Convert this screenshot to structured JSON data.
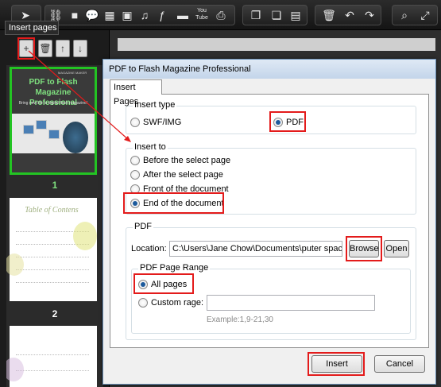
{
  "tooltip": "Insert pages",
  "toolbar": {
    "icons": [
      "cursor-icon",
      "link-icon",
      "shapes-icon",
      "speech-icon",
      "film-icon",
      "image-icon",
      "music-icon",
      "flash-icon",
      "button-icon",
      "youtube-icon",
      "printer-icon",
      "copy-page-icon",
      "paste-page-icon",
      "layout-icon",
      "trash-icon",
      "undo-icon",
      "redo-icon",
      "zoom-icon",
      "fit-icon"
    ],
    "youtube_label": "You Tube"
  },
  "left_panel": {
    "thumbnails": [
      {
        "number": "1",
        "title": "PDF to Flash Magazine Professional",
        "subtitle": "Bring new life to digital flash magazine!",
        "brand": "MAGAZINE MAKER"
      },
      {
        "number": "2",
        "title": "Table of Contens"
      },
      {
        "number": ""
      }
    ]
  },
  "dialog": {
    "title": "PDF to Flash Magazine Professional",
    "tab": "Insert Pages",
    "insert_type": {
      "label": "Insert type",
      "options": [
        {
          "label": "SWF/IMG",
          "selected": false
        },
        {
          "label": "PDF",
          "selected": true
        }
      ]
    },
    "insert_to": {
      "label": "Insert to",
      "options": [
        {
          "label": "Before the select page",
          "selected": false
        },
        {
          "label": "After the select page",
          "selected": false
        },
        {
          "label": "Front of the document",
          "selected": false
        },
        {
          "label": "End of the document",
          "selected": true
        }
      ]
    },
    "pdf": {
      "label": "PDF",
      "location_label": "Location:",
      "location_value": "C:\\Users\\Jane Chow\\Documents\\puter space.pdf",
      "browse_label": "Browse",
      "open_label": "Open",
      "range": {
        "label": "PDF Page Range",
        "all_pages_label": "All pages",
        "all_pages_selected": true,
        "custom_label": "Custom rage:",
        "custom_value": "",
        "example": "Example:1,9-21,30"
      }
    },
    "insert_label": "Insert",
    "cancel_label": "Cancel"
  },
  "colors": {
    "highlight": "#e31b1b",
    "selected_thumb_border": "#23c423"
  }
}
